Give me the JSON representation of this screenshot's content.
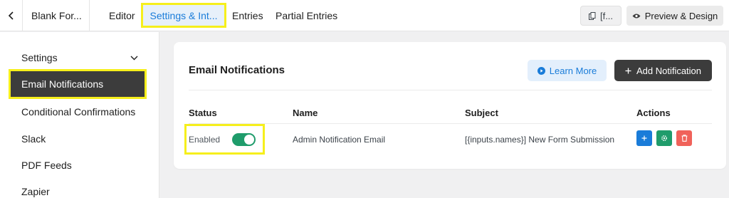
{
  "header": {
    "form_title": "Blank For...",
    "tabs": [
      {
        "label": "Editor"
      },
      {
        "label": "Settings & Int..."
      },
      {
        "label": "Entries"
      },
      {
        "label": "Partial Entries"
      }
    ],
    "shortcode_label": "[f...",
    "preview_label": "Preview & Design"
  },
  "sidebar": {
    "items": [
      {
        "label": "Settings"
      },
      {
        "label": "Email Notifications"
      },
      {
        "label": "Conditional Confirmations"
      },
      {
        "label": "Slack"
      },
      {
        "label": "PDF Feeds"
      },
      {
        "label": "Zapier"
      }
    ]
  },
  "main": {
    "title": "Email Notifications",
    "learn_more_label": "Learn More",
    "add_notification_label": "Add Notification",
    "table": {
      "headers": [
        "Status",
        "Name",
        "Subject",
        "Actions"
      ],
      "rows": [
        {
          "status": "Enabled",
          "enabled": true,
          "name": "Admin Notification Email",
          "subject": "[{inputs.names}] New Form Submission"
        }
      ]
    }
  },
  "colors": {
    "accent": "#1a7cd9",
    "success": "#1f9c6b",
    "danger": "#f0625a",
    "dark": "#3c3c3c",
    "highlight": "#f6ef1c"
  }
}
